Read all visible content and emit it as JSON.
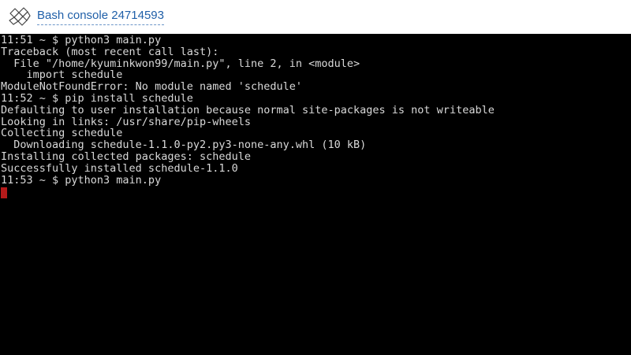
{
  "header": {
    "title": "Bash console 24714593",
    "logo_icon": "pythonanywhere-logo-icon",
    "title_color": "#1f5fa8"
  },
  "terminal": {
    "background": "#000000",
    "text_color": "#d9d9d9",
    "cursor_color": "#b51a1a",
    "lines": [
      "11:51 ~ $ python3 main.py",
      "Traceback (most recent call last):",
      "  File \"/home/kyuminkwon99/main.py\", line 2, in <module>",
      "    import schedule",
      "ModuleNotFoundError: No module named 'schedule'",
      "11:52 ~ $ pip install schedule",
      "Defaulting to user installation because normal site-packages is not writeable",
      "Looking in links: /usr/share/pip-wheels",
      "Collecting schedule",
      "  Downloading schedule-1.1.0-py2.py3-none-any.whl (10 kB)",
      "Installing collected packages: schedule",
      "Successfully installed schedule-1.1.0",
      "11:53 ~ $ python3 main.py"
    ]
  }
}
